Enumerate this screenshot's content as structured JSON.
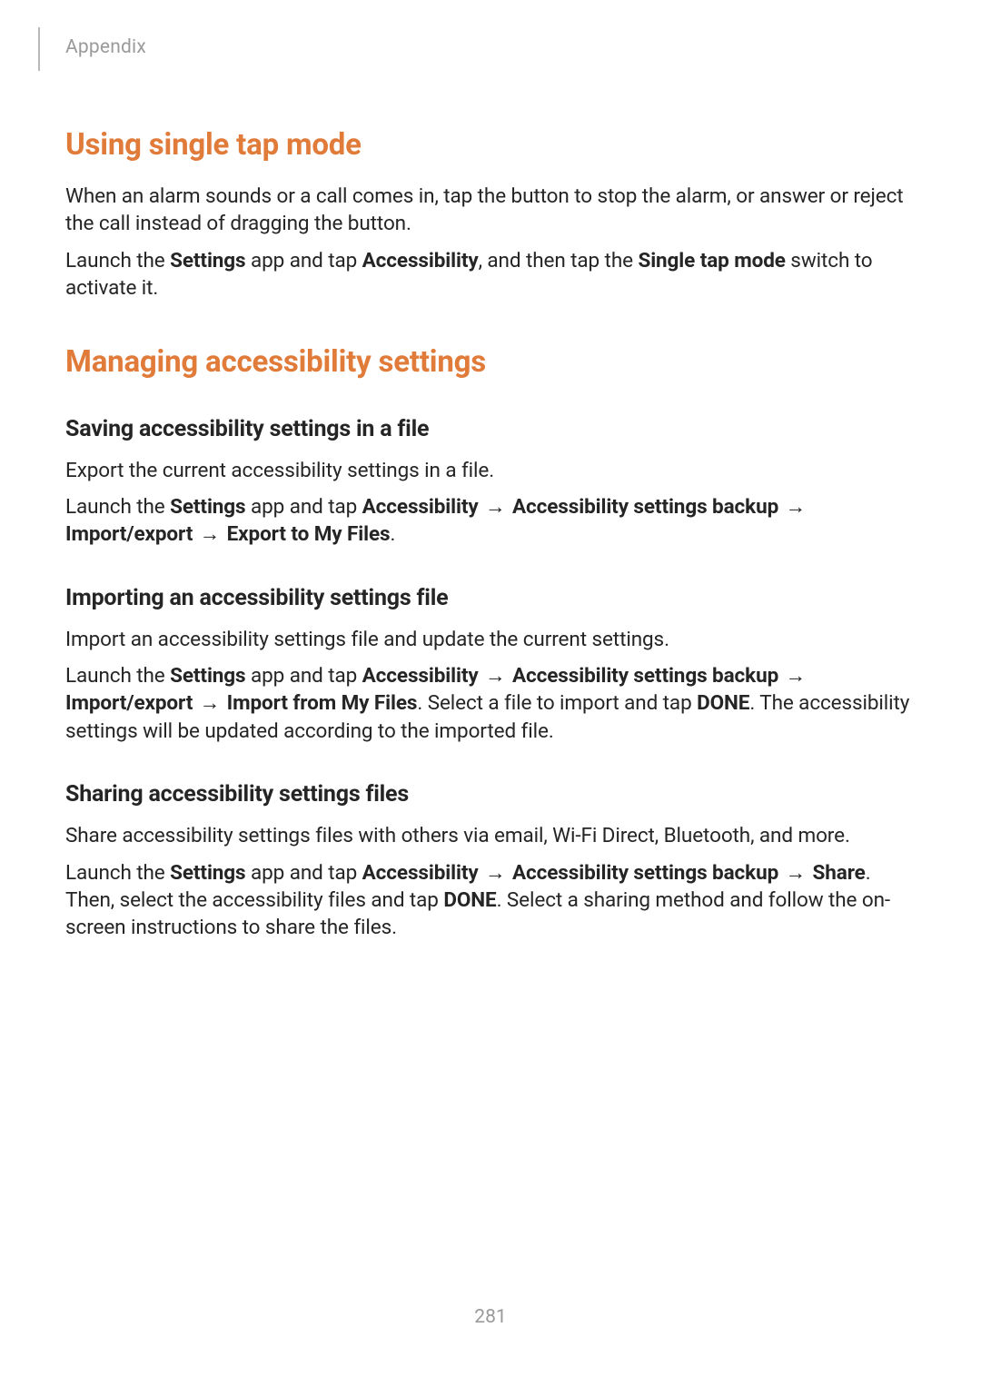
{
  "header": {
    "section": "Appendix"
  },
  "h1_a": "Using single tap mode",
  "p1": "When an alarm sounds or a call comes in, tap the button to stop the alarm, or answer or reject the call instead of dragging the button.",
  "p2_pre": "Launch the ",
  "p2_b1": "Settings",
  "p2_mid1": " app and tap ",
  "p2_b2": "Accessibility",
  "p2_mid2": ", and then tap the ",
  "p2_b3": "Single tap mode",
  "p2_post": " switch to activate it.",
  "h1_b": "Managing accessibility settings",
  "h2_a": "Saving accessibility settings in a file",
  "p3": "Export the current accessibility settings in a file.",
  "p4_pre": "Launch the ",
  "p4_b1": "Settings",
  "p4_mid1": " app and tap ",
  "p4_b2": "Accessibility",
  "arrow": " → ",
  "p4_b3": "Accessibility settings backup",
  "p4_b4": "Import/export",
  "p4_b5": "Export to My Files",
  "p4_end": ".",
  "h2_b": "Importing an accessibility settings file",
  "p5": "Import an accessibility settings file and update the current settings.",
  "p6_pre": "Launch the ",
  "p6_b1": "Settings",
  "p6_mid1": " app and tap ",
  "p6_b2": "Accessibility",
  "p6_b3": "Accessibility settings backup",
  "p6_b4": "Import/export",
  "p6_b5": "Import from My Files",
  "p6_mid2": ". Select a file to import and tap ",
  "p6_b6": "DONE",
  "p6_post": ". The accessibility settings will be updated according to the imported file.",
  "h2_c": "Sharing accessibility settings files",
  "p7": "Share accessibility settings files with others via email, Wi-Fi Direct, Bluetooth, and more.",
  "p8_pre": "Launch the ",
  "p8_b1": "Settings",
  "p8_mid1": " app and tap ",
  "p8_b2": "Accessibility",
  "p8_b3": "Accessibility settings backup",
  "p8_b4": "Share",
  "p8_mid2": ". Then, select the accessibility files and tap ",
  "p8_b5": "DONE",
  "p8_post": ". Select a sharing method and follow the on-screen instructions to share the files.",
  "page_number": "281"
}
